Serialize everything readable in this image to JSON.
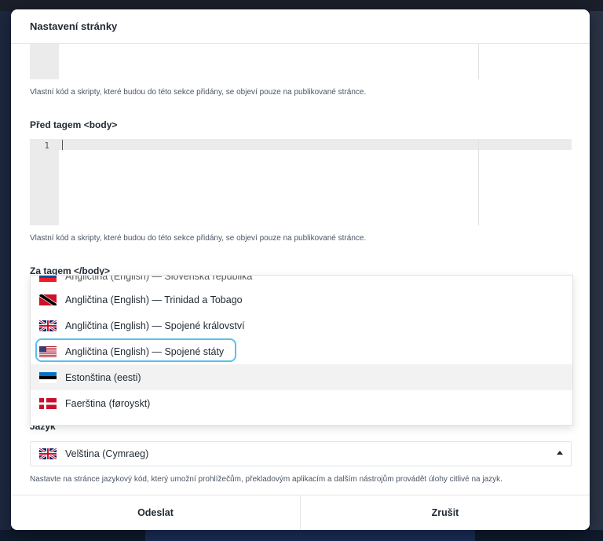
{
  "dialog": {
    "title": "Nastavení stránky",
    "hint_code": "Vlastní kód a skripty, které budou do této sekce přidány, se objeví pouze na publikované stránce.",
    "section_before_body": "Před tagem <body>",
    "line_number": "1",
    "section_after_body": "Za tagem </body>",
    "language_label": "Jazyk",
    "language_hint": "Nastavte na stránce jazykový kód, který umožní prohlížečům, překladovým aplikacím a dalším nástrojům provádět úlohy citlivé na jazyk.",
    "language_selected": "Velština (Cymraeg)",
    "language_selected_icon": "flag-uk-icon",
    "submit_label": "Odeslat",
    "cancel_label": "Zrušit"
  },
  "language_options": [
    {
      "label": "Angličtina (English) — Slovenská republika",
      "icon": "flag-slovakia-icon",
      "state": "partially-visible"
    },
    {
      "label": "Angličtina (English) — Trinidad a Tobago",
      "icon": "flag-trinidad-icon"
    },
    {
      "label": "Angličtina (English) — Spojené království",
      "icon": "flag-uk-icon"
    },
    {
      "label": "Angličtina (English) — Spojené státy",
      "icon": "flag-us-icon",
      "state": "selected"
    },
    {
      "label": "Estonština (eesti)",
      "icon": "flag-estonia-icon",
      "state": "hover"
    },
    {
      "label": "Faerština (føroyskt)",
      "icon": "flag-denmark-icon"
    }
  ],
  "colors": {
    "focus_ring": "#5bc0eb",
    "hover_row": "#f2f2f2",
    "gutter": "#ebebeb"
  }
}
